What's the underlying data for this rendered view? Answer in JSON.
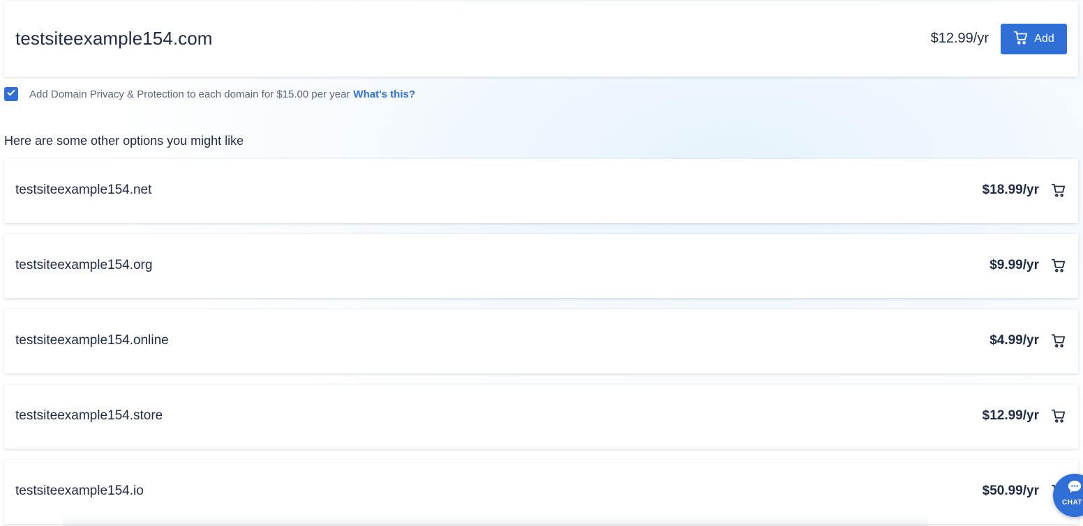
{
  "main_result": {
    "domain": "testsiteexample154.com",
    "price": "$12.99/yr",
    "add_label": "Add"
  },
  "privacy": {
    "checked": true,
    "text": "Add Domain Privacy & Protection to each domain for $15.00 per year",
    "link_label": "What's this?"
  },
  "suggestions": {
    "title": "Here are some other options you might like",
    "items": [
      {
        "domain": "testsiteexample154.net",
        "price": "$18.99/yr"
      },
      {
        "domain": "testsiteexample154.org",
        "price": "$9.99/yr"
      },
      {
        "domain": "testsiteexample154.online",
        "price": "$4.99/yr"
      },
      {
        "domain": "testsiteexample154.store",
        "price": "$12.99/yr"
      },
      {
        "domain": "testsiteexample154.io",
        "price": "$50.99/yr"
      }
    ]
  },
  "chat": {
    "label": "CHAT"
  },
  "colors": {
    "accent": "#2f6fd6",
    "text": "#1f2a44",
    "muted": "#5b6478"
  },
  "icons": {
    "cart": "cart-icon",
    "check": "checkmark-icon",
    "chat": "chat-bubble-icon"
  }
}
